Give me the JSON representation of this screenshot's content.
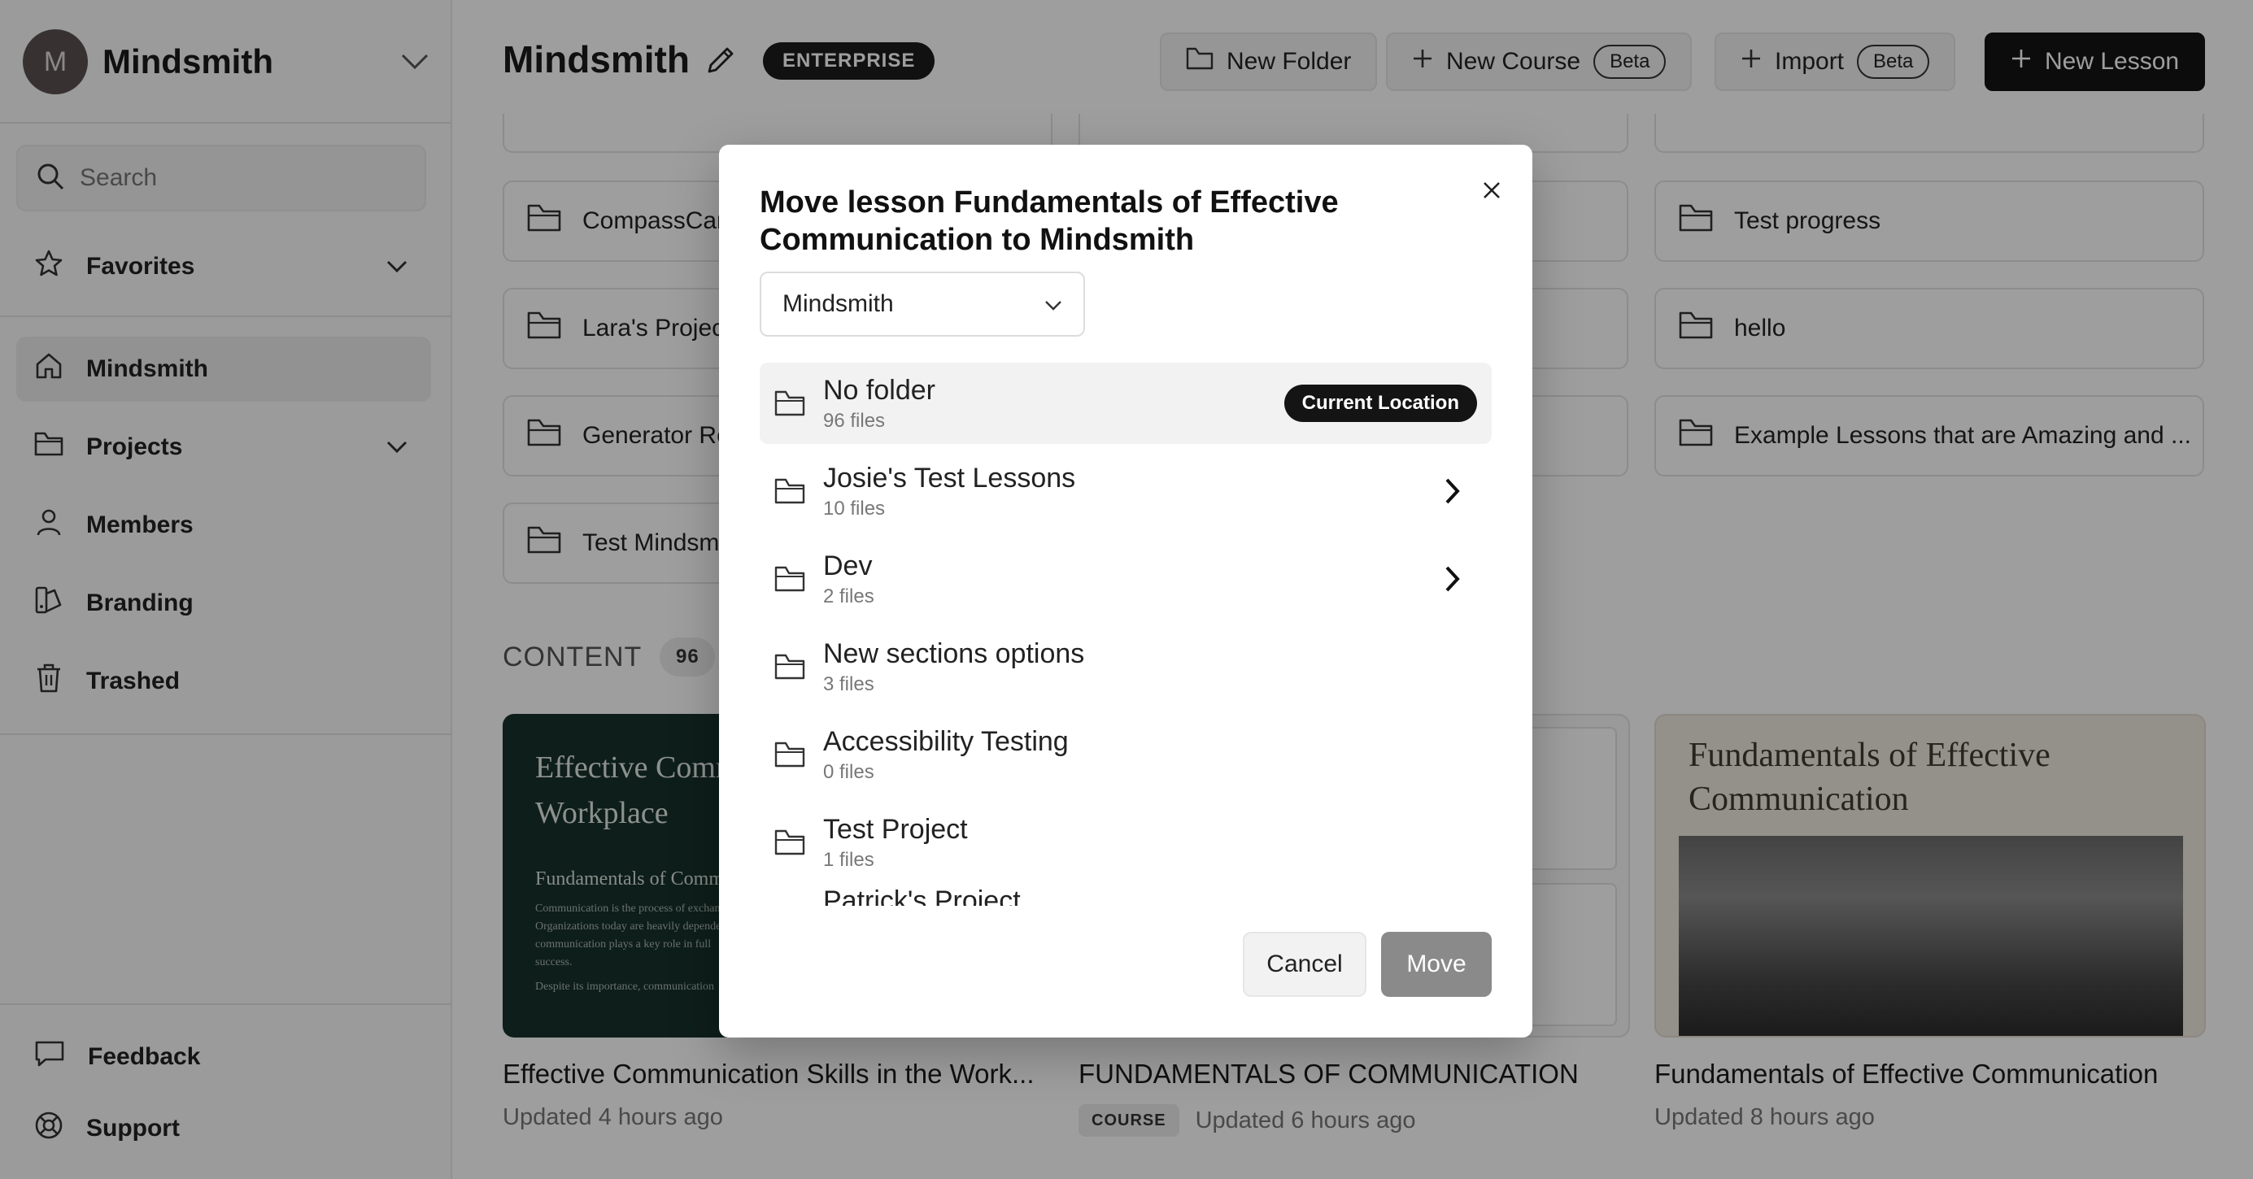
{
  "sidebar": {
    "workspace_initial": "M",
    "workspace_name": "Mindsmith",
    "search_placeholder": "Search",
    "items": [
      {
        "label": "Favorites"
      },
      {
        "label": "Mindsmith"
      },
      {
        "label": "Projects"
      },
      {
        "label": "Members"
      },
      {
        "label": "Branding"
      },
      {
        "label": "Trashed"
      },
      {
        "label": "Feedback"
      },
      {
        "label": "Support"
      }
    ]
  },
  "header": {
    "title": "Mindsmith",
    "plan_badge": "ENTERPRISE",
    "new_folder": "New Folder",
    "new_course": "New Course",
    "import": "Import",
    "beta": "Beta",
    "new_lesson": "New Lesson"
  },
  "folders": [
    {
      "name": "CompassCar"
    },
    {
      "name": "Test progress"
    },
    {
      "name": "Lara's Projec"
    },
    {
      "name": "hello"
    },
    {
      "name": "Generator Re"
    },
    {
      "name": "Example Lessons that are Amazing and ..."
    },
    {
      "name": "Test Mindsm"
    }
  ],
  "content": {
    "label": "CONTENT",
    "count": "96",
    "lessons": [
      {
        "title": "Effective Communication Skills in the Work...",
        "updated": "Updated 4 hours ago",
        "thumb_heading": "Effective Communication in the Workplace",
        "thumb_sub": "Fundamentals of Commu",
        "thumb_body_1": "Communication is the process of exchan",
        "thumb_body_2": "Organizations today are heavily depende",
        "thumb_body_3": "communication plays a key role in full",
        "thumb_body_4": "success.",
        "thumb_body_5": "Despite its importance, communication"
      },
      {
        "title": "FUNDAMENTALS OF COMMUNICATION",
        "badge": "COURSE",
        "updated": "Updated 6 hours ago"
      },
      {
        "title": "Fundamentals of Effective Communication",
        "updated": "Updated 8 hours ago",
        "thumb_heading": "Fundamentals of Effective Communication"
      }
    ]
  },
  "modal": {
    "title": "Move lesson Fundamentals of Effective Communication to Mindsmith",
    "workspace_select": "Mindsmith",
    "current_location": "Current Location",
    "folders": [
      {
        "name": "No folder",
        "files": "96 files",
        "current": true
      },
      {
        "name": "Josie's Test Lessons",
        "files": "10 files",
        "has_children": true
      },
      {
        "name": "Dev",
        "files": "2 files",
        "has_children": true
      },
      {
        "name": "New sections options",
        "files": "3 files"
      },
      {
        "name": "Accessibility Testing",
        "files": "0 files"
      },
      {
        "name": "Test Project",
        "files": "1 files"
      },
      {
        "name": "Patrick's Project",
        "files": ""
      }
    ],
    "cancel": "Cancel",
    "move": "Move"
  }
}
